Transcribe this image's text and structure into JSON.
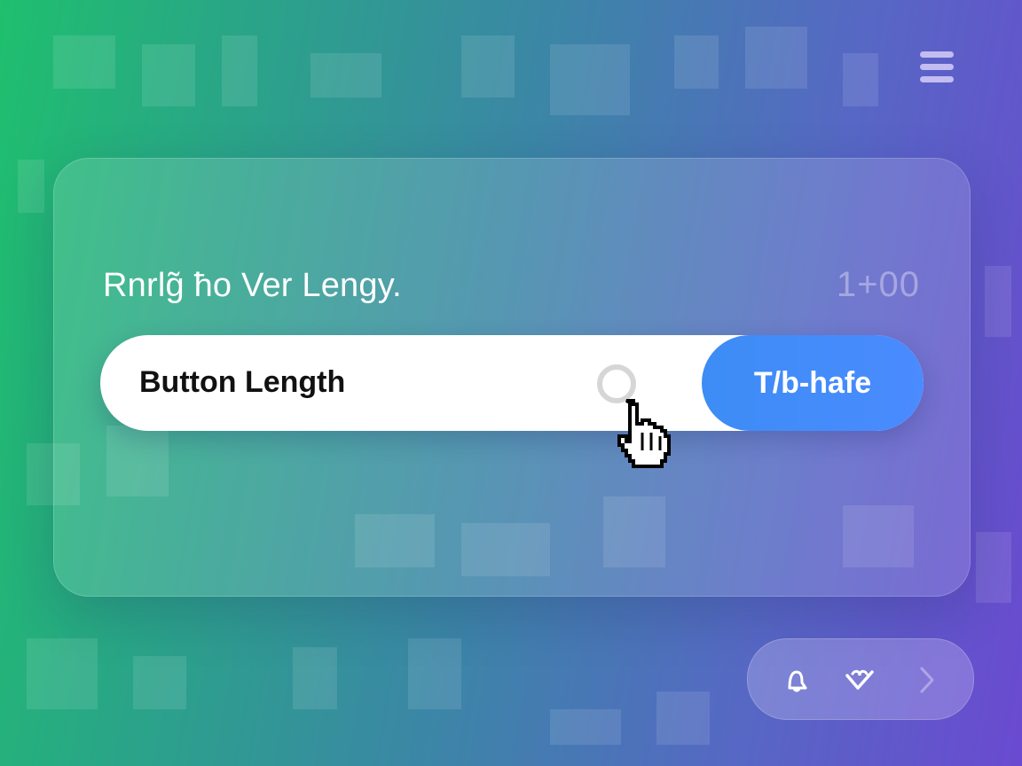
{
  "card": {
    "title": "Rnrlg̃ ħo Ver Lengy.",
    "counter": "1+00"
  },
  "slider_button": {
    "label": "Button Length",
    "action_label": "T/b-hafe",
    "action_color": "#3d8cf5"
  },
  "header": {
    "menu_icon": "hamburger-menu-icon"
  },
  "toolbar": {
    "icons": [
      "bell-icon",
      "heart-check-icon",
      "chevron-right-icon"
    ]
  },
  "colors": {
    "gradient_start": "#1fbf6e",
    "gradient_end": "#6a4ad0",
    "pill_background": "#ffffff",
    "label_text": "#111111"
  }
}
